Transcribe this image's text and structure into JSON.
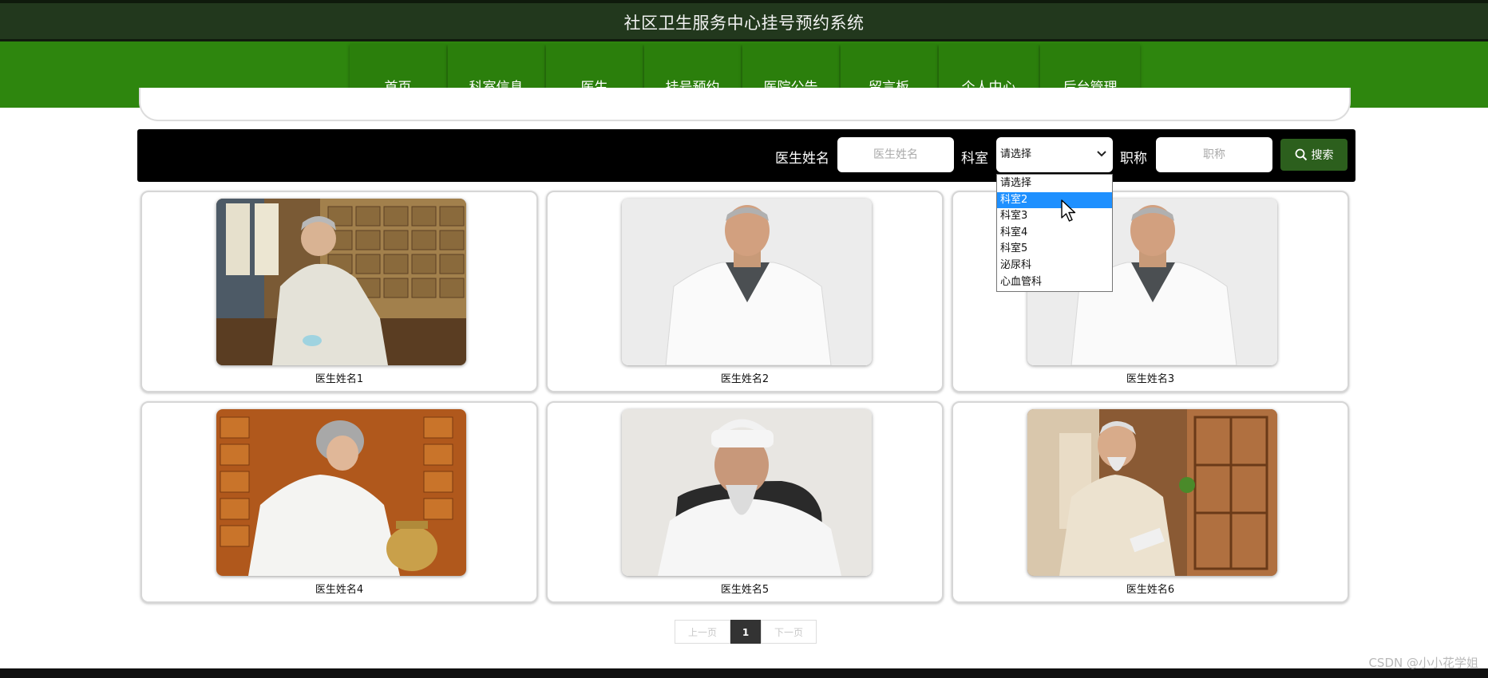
{
  "header": {
    "site_title": "社区卫生服务中心挂号预约系统"
  },
  "nav": {
    "items": [
      {
        "label": "首页"
      },
      {
        "label": "科室信息"
      },
      {
        "label": "医生"
      },
      {
        "label": "挂号预约"
      },
      {
        "label": "医院公告"
      },
      {
        "label": "留言板"
      },
      {
        "label": "个人中心"
      },
      {
        "label": "后台管理"
      }
    ]
  },
  "search": {
    "doctor_name_label": "医生姓名",
    "doctor_name_placeholder": "医生姓名",
    "department_label": "科室",
    "department_selected": "请选择",
    "title_label": "职称",
    "title_placeholder": "职称",
    "search_button_label": "搜索",
    "department_options": [
      "请选择",
      "科室2",
      "科室3",
      "科室4",
      "科室5",
      "泌尿科",
      "心血管科"
    ],
    "highlighted_option": "科室2"
  },
  "doctors": [
    {
      "name": "医生姓名1"
    },
    {
      "name": "医生姓名2"
    },
    {
      "name": "医生姓名3"
    },
    {
      "name": "医生姓名4"
    },
    {
      "name": "医生姓名5"
    },
    {
      "name": "医生姓名6"
    }
  ],
  "pagination": {
    "prev_label": "上一页",
    "current_page": "1",
    "next_label": "下一页"
  },
  "watermark": "CSDN @小小花学姐",
  "colors": {
    "topbar": "#22381d",
    "navbar": "#2e860e",
    "search_button": "#2c5f1d",
    "highlight": "#1e90ff"
  }
}
